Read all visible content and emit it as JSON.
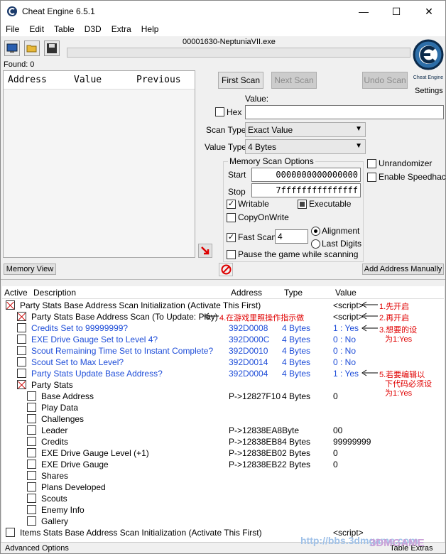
{
  "window": {
    "title": "Cheat Engine 6.5.1"
  },
  "controls": {
    "minimize": "—",
    "maximize": "☐",
    "close": "✕"
  },
  "menu": [
    "File",
    "Edit",
    "Table",
    "D3D",
    "Extra",
    "Help"
  ],
  "process": "00001630-NeptuniaVII.exe",
  "found": "Found: 0",
  "settings_label": "Settings",
  "logo_text": "Cheat Engine",
  "result_list": {
    "columns": [
      "Address",
      "Value",
      "Previous"
    ]
  },
  "scan": {
    "first_scan": "First Scan",
    "next_scan": "Next Scan",
    "undo_scan": "Undo Scan",
    "value_label": "Value:",
    "hex_label": "Hex",
    "scan_type_label": "Scan Type",
    "scan_type_value": "Exact Value",
    "value_type_label": "Value Type",
    "value_type_value": "4 Bytes",
    "unrandomizer": "Unrandomizer",
    "enable_speedhack": "Enable Speedhack"
  },
  "memory_options": {
    "title": "Memory Scan Options",
    "start_label": "Start",
    "start_value": "0000000000000000",
    "stop_label": "Stop",
    "stop_value": "7fffffffffffffff",
    "writable": "Writable",
    "executable": "Executable",
    "copy_on_write": "CopyOnWrite",
    "fast_scan": "Fast Scan",
    "fast_scan_value": "4",
    "alignment": "Alignment",
    "last_digits": "Last Digits",
    "pause": "Pause the game while scanning"
  },
  "bottom": {
    "memory_view": "Memory View",
    "add_address": "Add Address Manually"
  },
  "table": {
    "columns": [
      "Active",
      "Description",
      "Address",
      "Type",
      "Value"
    ],
    "rows": [
      {
        "desc": "Party Stats Base Address Scan Initialization (Activate This First)",
        "address": "",
        "type": "",
        "value": "<script>",
        "checked": true,
        "indent": 0,
        "blue": false
      },
      {
        "desc": "Party Stats Base Address Scan (To Update: Play)",
        "address": "",
        "type": "",
        "value": "<script>",
        "checked": true,
        "indent": 1,
        "blue": false
      },
      {
        "desc": "Credits Set to 99999999?",
        "address": "392D0008",
        "type": "4 Bytes",
        "value": "1 : Yes",
        "checked": false,
        "indent": 1,
        "blue": true
      },
      {
        "desc": "EXE Drive Gauge Set to Level 4?",
        "address": "392D000C",
        "type": "4 Bytes",
        "value": "0 : No",
        "checked": false,
        "indent": 1,
        "blue": true
      },
      {
        "desc": "Scout Remaining Time Set to Instant Complete?",
        "address": "392D0010",
        "type": "4 Bytes",
        "value": "0 : No",
        "checked": false,
        "indent": 1,
        "blue": true
      },
      {
        "desc": "Scout Set to Max Level?",
        "address": "392D0014",
        "type": "4 Bytes",
        "value": "0 : No",
        "checked": false,
        "indent": 1,
        "blue": true
      },
      {
        "desc": "Party Stats Update Base Address?",
        "address": "392D0004",
        "type": "4 Bytes",
        "value": "1 : Yes",
        "checked": false,
        "indent": 1,
        "blue": true
      },
      {
        "desc": "Party Stats",
        "address": "",
        "type": "",
        "value": "",
        "checked": true,
        "indent": 1,
        "blue": false
      },
      {
        "desc": "Base Address",
        "address": "P->12827F10",
        "type": "4 Bytes",
        "value": "0",
        "checked": false,
        "indent": 2,
        "blue": false
      },
      {
        "desc": "Play Data",
        "address": "",
        "type": "",
        "value": "",
        "checked": false,
        "indent": 2,
        "blue": false
      },
      {
        "desc": "Challenges",
        "address": "",
        "type": "",
        "value": "",
        "checked": false,
        "indent": 2,
        "blue": false
      },
      {
        "desc": "Leader",
        "address": "P->12838EA8",
        "type": "Byte",
        "value": "00",
        "checked": false,
        "indent": 2,
        "blue": false
      },
      {
        "desc": "Credits",
        "address": "P->12838EB8",
        "type": "4 Bytes",
        "value": "99999999",
        "checked": false,
        "indent": 2,
        "blue": false
      },
      {
        "desc": "EXE Drive Gauge Level (+1)",
        "address": "P->12838EB0",
        "type": "2 Bytes",
        "value": "0",
        "checked": false,
        "indent": 2,
        "blue": false
      },
      {
        "desc": "EXE Drive Gauge",
        "address": "P->12838EB2",
        "type": "2 Bytes",
        "value": "0",
        "checked": false,
        "indent": 2,
        "blue": false
      },
      {
        "desc": "Shares",
        "address": "",
        "type": "",
        "value": "",
        "checked": false,
        "indent": 2,
        "blue": false
      },
      {
        "desc": "Plans Developed",
        "address": "",
        "type": "",
        "value": "",
        "checked": false,
        "indent": 2,
        "blue": false
      },
      {
        "desc": "Scouts",
        "address": "",
        "type": "",
        "value": "",
        "checked": false,
        "indent": 2,
        "blue": false
      },
      {
        "desc": "Enemy Info",
        "address": "",
        "type": "",
        "value": "",
        "checked": false,
        "indent": 2,
        "blue": false
      },
      {
        "desc": "Gallery",
        "address": "",
        "type": "",
        "value": "",
        "checked": false,
        "indent": 2,
        "blue": false
      },
      {
        "desc": "Items Stats Base Address Scan Initialization (Activate This First)",
        "address": "",
        "type": "",
        "value": "<script>",
        "checked": false,
        "indent": 0,
        "blue": false
      }
    ]
  },
  "annotations": {
    "a1": "1.先开启",
    "a2": "2.再开启",
    "a3_line1": "3.想要的设",
    "a3_line2": "为1:Yes",
    "a4": "4.在游戏里照操作指示做",
    "a5_line1": "5.若要编辑以",
    "a5_line2": "下代码必须设",
    "a5_line3": "为1:Yes"
  },
  "status": {
    "advanced_options": "Advanced Options",
    "table_extras": "Table Extras"
  },
  "watermark": {
    "site": "http://bbs.3dmgame.com",
    "logo": "3DMGAME"
  }
}
